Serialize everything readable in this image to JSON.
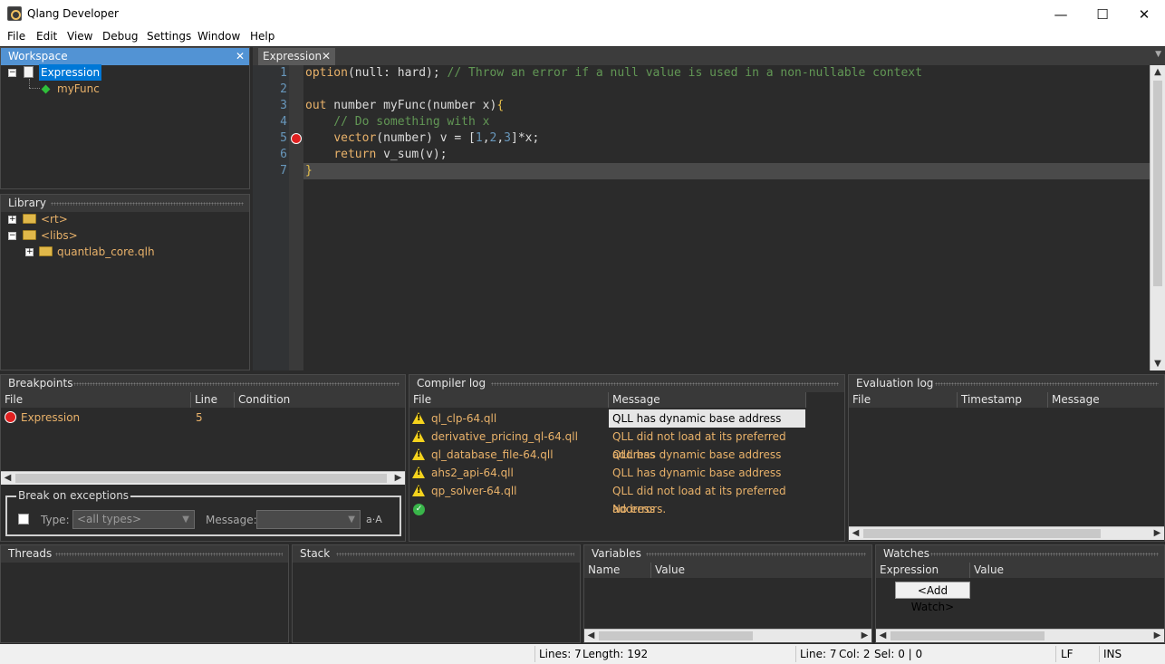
{
  "window": {
    "title": "Qlang Developer",
    "minimize": "—",
    "maximize": "☐",
    "close": "✕"
  },
  "menu": [
    "File",
    "Edit",
    "View",
    "Debug",
    "Settings",
    "Window",
    "Help"
  ],
  "workspace": {
    "title": "Workspace",
    "close": "✕",
    "items": [
      {
        "label": "Expression"
      },
      {
        "label": "myFunc"
      }
    ]
  },
  "library": {
    "title": "Library",
    "items": [
      {
        "label": "<rt>"
      },
      {
        "label": "<libs>"
      },
      {
        "label": "quantlab_core.qlh"
      }
    ]
  },
  "editor": {
    "tab_label": "Expression",
    "tab_close": "✕",
    "line_numbers": [
      "1",
      "2",
      "3",
      "4",
      "5",
      "6",
      "7"
    ],
    "lines": [
      {
        "parts": [
          {
            "t": "option",
            "c": "kw"
          },
          {
            "t": "(null: hard); ",
            "c": ""
          },
          {
            "t": "// Throw an error if a null value is used in a non-nullable context",
            "c": "cm"
          }
        ]
      },
      {
        "parts": []
      },
      {
        "parts": [
          {
            "t": "out",
            "c": "kw"
          },
          {
            "t": " number myFunc(number x)",
            "c": ""
          },
          {
            "t": "{",
            "c": "br"
          }
        ]
      },
      {
        "parts": [
          {
            "t": "    // Do something with x",
            "c": "cm"
          }
        ]
      },
      {
        "parts": [
          {
            "t": "    ",
            "c": ""
          },
          {
            "t": "vector",
            "c": "kw"
          },
          {
            "t": "(number) v = [",
            "c": ""
          },
          {
            "t": "1",
            "c": "num"
          },
          {
            "t": ",",
            "c": ""
          },
          {
            "t": "2",
            "c": "num"
          },
          {
            "t": ",",
            "c": ""
          },
          {
            "t": "3",
            "c": "num"
          },
          {
            "t": "]*x;",
            "c": ""
          }
        ]
      },
      {
        "parts": [
          {
            "t": "    ",
            "c": ""
          },
          {
            "t": "return",
            "c": "kw"
          },
          {
            "t": " v_sum(v);",
            "c": ""
          }
        ]
      },
      {
        "parts": [
          {
            "t": "}",
            "c": "br"
          }
        ]
      }
    ],
    "breakpoint_line": "5"
  },
  "breakpoints": {
    "title": "Breakpoints",
    "columns": [
      "File",
      "Line",
      "Condition"
    ],
    "rows": [
      {
        "file": "Expression",
        "line": "5",
        "condition": ""
      }
    ]
  },
  "break_on_exceptions": {
    "title": "Break on exceptions",
    "type_label": "Type:",
    "type_value": "<all types>",
    "message_label": "Message:",
    "message_value": "",
    "regex_icon": "a·A"
  },
  "compiler_log": {
    "title": "Compiler log",
    "columns": [
      "File",
      "Message"
    ],
    "rows": [
      {
        "icon": "warning",
        "file": "ql_clp-64.qll",
        "message": "QLL has dynamic base address"
      },
      {
        "icon": "warning",
        "file": "derivative_pricing_ql-64.qll",
        "message": "QLL did not load at its preferred address"
      },
      {
        "icon": "warning",
        "file": "ql_database_file-64.qll",
        "message": "QLL has dynamic base address"
      },
      {
        "icon": "warning",
        "file": "ahs2_api-64.qll",
        "message": "QLL has dynamic base address"
      },
      {
        "icon": "warning",
        "file": "qp_solver-64.qll",
        "message": "QLL did not load at its preferred address"
      },
      {
        "icon": "ok",
        "file": "",
        "message": "No errors."
      }
    ]
  },
  "evaluation_log": {
    "title": "Evaluation log",
    "columns": [
      "File",
      "Timestamp",
      "Message"
    ]
  },
  "threads": {
    "title": "Threads"
  },
  "stack": {
    "title": "Stack"
  },
  "variables": {
    "title": "Variables",
    "columns": [
      "Name",
      "Value"
    ]
  },
  "watches": {
    "title": "Watches",
    "columns": [
      "Expression",
      "Value"
    ],
    "add_watch": "<Add Watch>"
  },
  "status": {
    "lines": "Lines: 7",
    "length": "Length: 192",
    "line": "Line: 7",
    "col": "Col: 2",
    "sel": "Sel: 0 | 0",
    "eol": "LF",
    "mode": "INS"
  },
  "colors": {
    "accent": "#5293d4",
    "orange_text": "#e9b26a",
    "comment": "#629755",
    "number": "#6897bb"
  }
}
